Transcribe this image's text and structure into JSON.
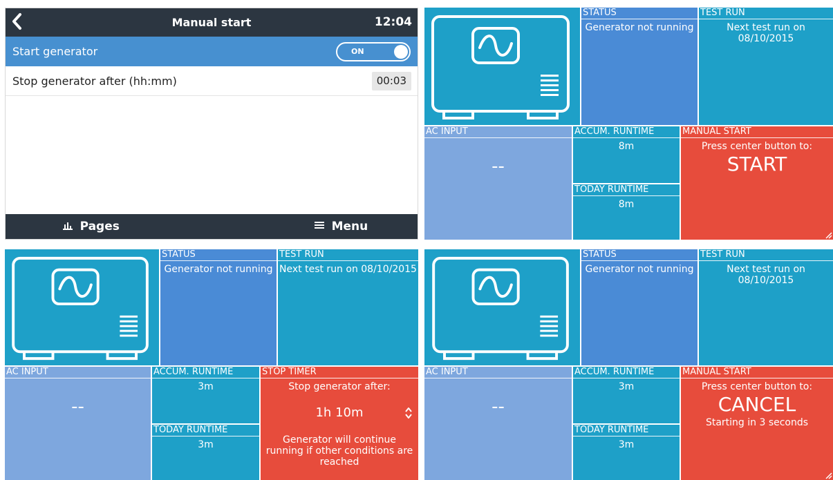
{
  "settings": {
    "title": "Manual start",
    "clock": "12:04",
    "back_glyph": "<",
    "start_label": "Start generator",
    "toggle_value": "ON",
    "stop_label": "Stop generator after (hh:mm)",
    "stop_value": "00:03",
    "pages_label": "Pages",
    "menu_label": "Menu",
    "pages_icon": "chart-icon",
    "menu_icon": "hamburger-icon"
  },
  "panel_tr": {
    "status_head": "STATUS",
    "status_text": "Generator not running",
    "test_head": "TEST RUN",
    "test_text": "Next test run on 08/10/2015",
    "ac_head": "AC INPUT",
    "ac_value": "--",
    "accum_head": "ACCUM. RUNTIME",
    "accum_value": "8m",
    "today_head": "TODAY RUNTIME",
    "today_value": "8m",
    "manual_head": "MANUAL START",
    "manual_prompt": "Press center button to:",
    "manual_action": "START"
  },
  "panel_bl": {
    "status_head": "STATUS",
    "status_text": "Generator not running",
    "test_head": "TEST RUN",
    "test_text": "Next test run on 08/10/2015",
    "ac_head": "AC INPUT",
    "ac_value": "--",
    "accum_head": "ACCUM. RUNTIME",
    "accum_value": "3m",
    "today_head": "TODAY RUNTIME",
    "today_value": "3m",
    "timer_head": "STOP TIMER",
    "timer_prompt": "Stop generator after:",
    "timer_value": "1h 10m",
    "timer_note": "Generator will continue running if other conditions are reached"
  },
  "panel_br": {
    "status_head": "STATUS",
    "status_text": "Generator not running",
    "test_head": "TEST RUN",
    "test_text": "Next test run on 08/10/2015",
    "ac_head": "AC INPUT",
    "ac_value": "--",
    "accum_head": "ACCUM. RUNTIME",
    "accum_value": "3m",
    "today_head": "TODAY RUNTIME",
    "today_value": "3m",
    "manual_head": "MANUAL START",
    "manual_prompt": "Press center button to:",
    "manual_action": "CANCEL",
    "manual_note": "Starting in 3 seconds"
  },
  "colors": {
    "titlebar": "#2c3641",
    "highlight_row": "#4790d0",
    "tile_teal": "#1ea0c8",
    "tile_status": "#4a8bd6",
    "tile_ac": "#7ea7de",
    "tile_red": "#e74c3c"
  }
}
